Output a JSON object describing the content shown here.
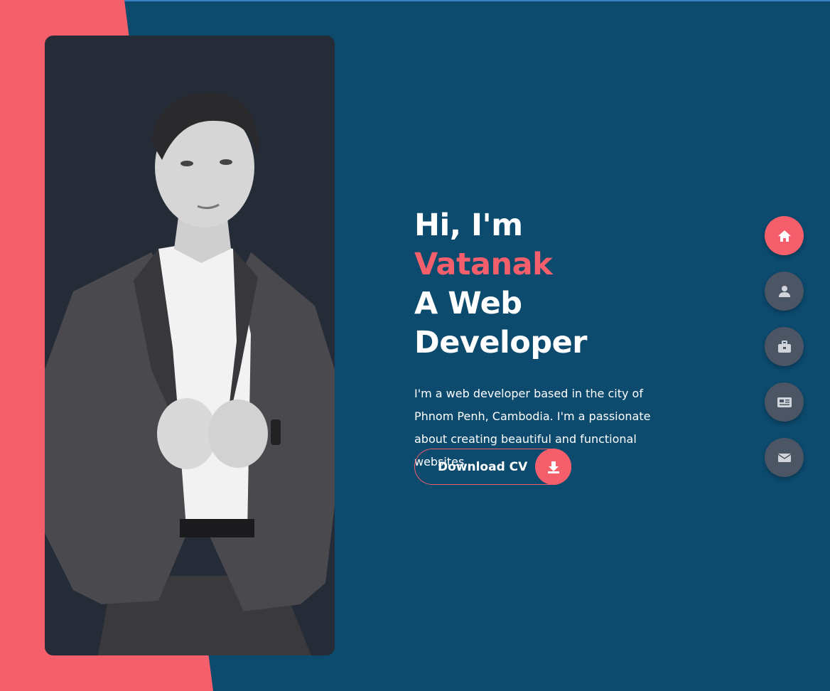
{
  "hero": {
    "greeting": "Hi, I'm ",
    "name": "Vatanak",
    "role_line1": "A Web",
    "role_line2": "Developer",
    "intro": "I'm a web developer based in the city of Phnom Penh, Cambodia. I'm a passionate about creating beautiful and functional websites.",
    "cv_button_label": "Download CV",
    "cv_button_icon": "download-icon"
  },
  "nav": [
    {
      "icon": "home-icon",
      "active": true
    },
    {
      "icon": "user-icon",
      "active": false
    },
    {
      "icon": "briefcase-icon",
      "active": false
    },
    {
      "icon": "newspaper-icon",
      "active": false
    },
    {
      "icon": "envelope-icon",
      "active": false
    }
  ],
  "colors": {
    "background": "#0c4a6e",
    "accent": "#f55f6c",
    "card": "#262b38",
    "nav_inactive": "#4b5563",
    "text": "#ffffff"
  }
}
